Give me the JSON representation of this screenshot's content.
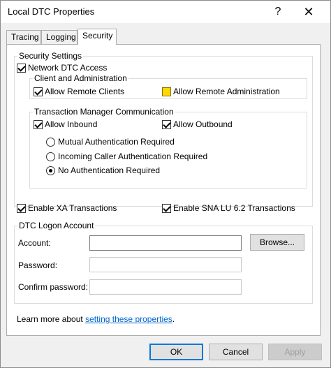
{
  "window": {
    "title": "Local DTC Properties",
    "help_glyph": "?",
    "close_glyph": "✕"
  },
  "tabs": [
    {
      "label": "Tracing",
      "active": false
    },
    {
      "label": "Logging",
      "active": false
    },
    {
      "label": "Security",
      "active": true
    }
  ],
  "security_settings": {
    "legend": "Security Settings",
    "network_dtc_access": {
      "label": "Network DTC Access",
      "checked": true
    },
    "client_admin": {
      "legend": "Client and Administration",
      "allow_remote_clients": {
        "label": "Allow Remote Clients",
        "checked": true
      },
      "allow_remote_admin": {
        "label": "Allow Remote Administration",
        "checked": false
      }
    },
    "tm_comm": {
      "legend": "Transaction Manager Communication",
      "allow_inbound": {
        "label": "Allow Inbound",
        "checked": true
      },
      "allow_outbound": {
        "label": "Allow Outbound",
        "checked": true
      },
      "radios": [
        {
          "label": "Mutual Authentication Required",
          "selected": false
        },
        {
          "label": "Incoming Caller Authentication Required",
          "selected": false
        },
        {
          "label": "No Authentication Required",
          "selected": true
        }
      ]
    }
  },
  "enable_xa": {
    "label": "Enable XA Transactions",
    "checked": true
  },
  "enable_sna": {
    "label": "Enable SNA LU 6.2 Transactions",
    "checked": true
  },
  "logon": {
    "legend": "DTC Logon Account",
    "account_label": "Account:",
    "account_value": "",
    "browse_label": "Browse...",
    "password_label": "Password:",
    "password_value": "",
    "confirm_label": "Confirm password:",
    "confirm_value": ""
  },
  "learn_more": {
    "prefix": "Learn more about ",
    "link": "setting these properties",
    "suffix": "."
  },
  "buttons": {
    "ok": "OK",
    "cancel": "Cancel",
    "apply": "Apply"
  },
  "colors": {
    "accent": "#0078d7",
    "highlight": "#ffd800",
    "link": "#0066cc"
  }
}
